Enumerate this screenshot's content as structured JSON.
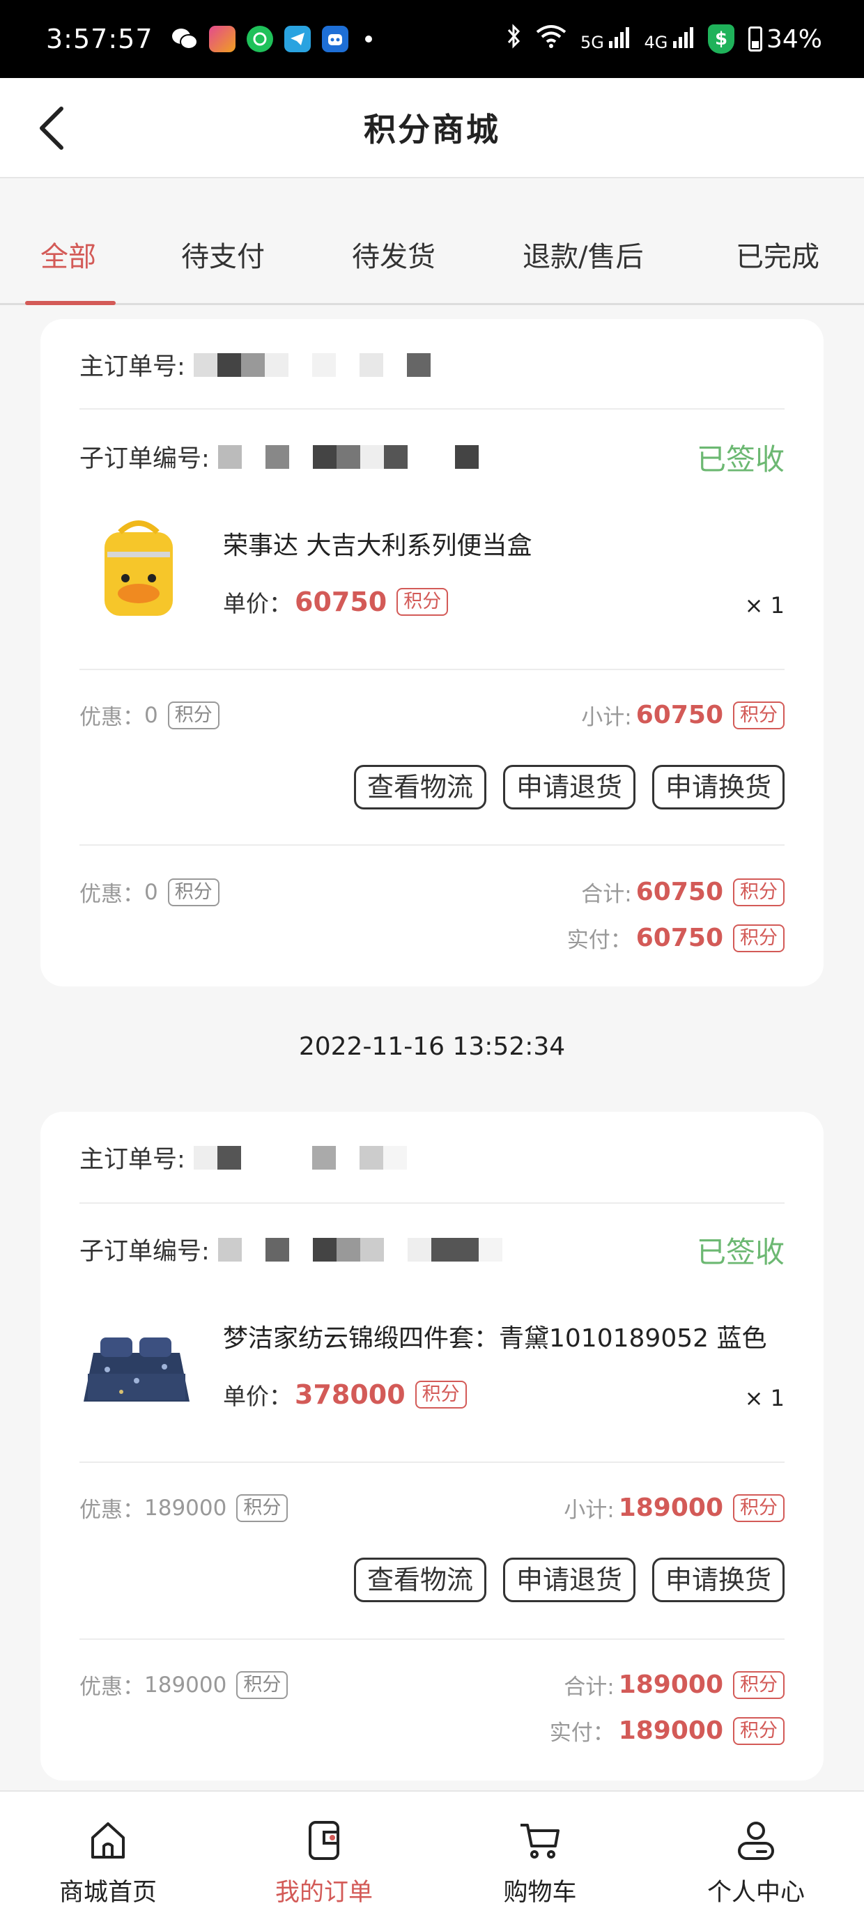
{
  "status_bar": {
    "time": "3:57:57",
    "battery": "34%",
    "net1": "5G",
    "net2": "4G"
  },
  "header": {
    "title": "积分商城"
  },
  "tabs": [
    {
      "label": "全部",
      "active": true
    },
    {
      "label": "待支付",
      "active": false
    },
    {
      "label": "待发货",
      "active": false
    },
    {
      "label": "退款/售后",
      "active": false
    },
    {
      "label": "已完成",
      "active": false
    }
  ],
  "labels": {
    "main_order": "主订单号:",
    "sub_order": "子订单编号:",
    "unit_price": "单价：",
    "points": "积分",
    "discount": "优惠：",
    "subtotal": "小计:",
    "total": "合计:",
    "paid": "实付："
  },
  "orders": [
    {
      "status": "已签收",
      "product_name": "荣事达 大吉大利系列便当盒",
      "unit_price": "60750",
      "quantity": "× 1",
      "item_discount": "0",
      "subtotal": "60750",
      "order_discount": "0",
      "total": "60750",
      "paid": "60750",
      "actions": [
        "查看物流",
        "申请退货",
        "申请换货"
      ]
    },
    {
      "datetime": "2022-11-16 13:52:34",
      "status": "已签收",
      "product_name": "梦洁家纺云锦缎四件套：青黛1010189052 蓝色",
      "unit_price": "378000",
      "quantity": "× 1",
      "item_discount": "189000",
      "subtotal": "189000",
      "order_discount": "189000",
      "total": "189000",
      "paid": "189000",
      "actions": [
        "查看物流",
        "申请退货",
        "申请换货"
      ]
    }
  ],
  "bottom_nav": [
    {
      "label": "商城首页",
      "icon": "home-icon",
      "active": false
    },
    {
      "label": "我的订单",
      "icon": "order-icon",
      "active": true
    },
    {
      "label": "购物车",
      "icon": "cart-icon",
      "active": false
    },
    {
      "label": "个人中心",
      "icon": "user-icon",
      "active": false
    }
  ],
  "colors": {
    "accent": "#d35a57",
    "status_green": "#6cb872",
    "bg": "#f6f6f6"
  }
}
